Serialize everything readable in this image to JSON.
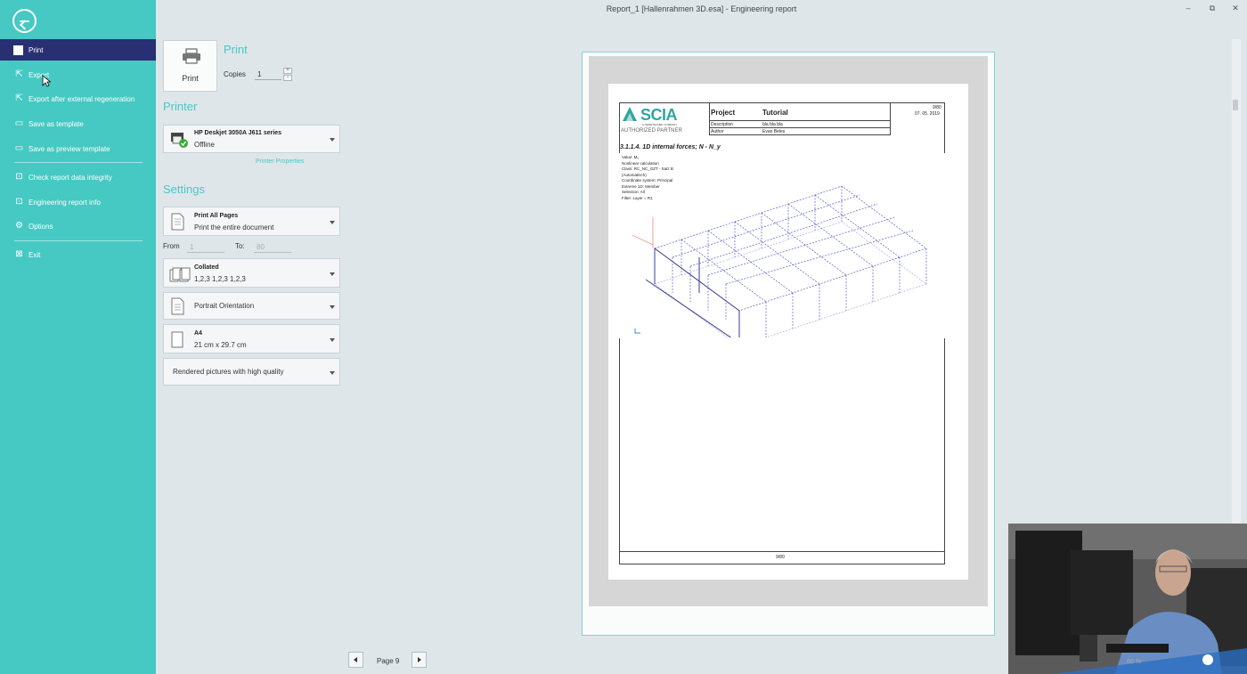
{
  "window": {
    "title": "Report_1 [Hallenrahmen 3D.esa] - Engineering report",
    "minimize": "–",
    "restore": "⧉",
    "close": "✕"
  },
  "sidebar": {
    "items": [
      {
        "label": "Print",
        "icon": "print-square-icon",
        "active": true
      },
      {
        "label": "Export",
        "icon": "export-icon"
      },
      {
        "label": "Export after external regeneration",
        "icon": "export-regenerate-icon"
      },
      {
        "label": "Save as template",
        "icon": "save-template-icon"
      },
      {
        "label": "Save as preview template",
        "icon": "save-preview-template-icon"
      },
      {
        "label": "Check report data integrity",
        "icon": "check-integrity-icon"
      },
      {
        "label": "Engineering report info",
        "icon": "report-info-icon"
      },
      {
        "label": "Options",
        "icon": "gear-icon"
      },
      {
        "label": "Exit",
        "icon": "exit-icon"
      }
    ]
  },
  "print_section": {
    "title": "Print",
    "button_label": "Print",
    "copies_label": "Copies",
    "copies_value": "1",
    "spin_up": "+",
    "spin_down": "-"
  },
  "printer_section": {
    "title": "Printer",
    "name": "HP Deskjet 3050A J611 series",
    "status": "Offline",
    "properties_link": "Printer Properties"
  },
  "settings_section": {
    "title": "Settings",
    "pages": {
      "title": "Print All Pages",
      "sub": "Print the entire document"
    },
    "from_label": "From",
    "from_value": "1",
    "to_label": "To:",
    "to_value": "80",
    "collation": {
      "title": "Collated",
      "sub": "1,2,3  1,2,3  1,2,3"
    },
    "orientation": "Portrait Orientation",
    "paper": {
      "title": "A4",
      "sub": "21 cm x 29.7 cm"
    },
    "quality": "Rendered pictures with high quality"
  },
  "preview": {
    "logo": "SCIA",
    "logo_tagline": "A NEMETSCHEK COMPANY",
    "partner": "AUTHORIZED PARTNER",
    "project_label": "Project",
    "project_value": "Tutorial",
    "page_num": "9/80",
    "date": "07. 05. 2019",
    "description_label": "Description",
    "description_value": "bla bla bla",
    "author_label": "Author",
    "author_value": "Evan Beles",
    "section_heading": "3.1.1.4.  1D internal forces; N - N_y",
    "params": [
      "Value: Mᵧ",
      "Nonlinear calculation",
      "Class: RC_NC_GZT - Satz B",
      "(Automatisch)",
      "Coordinate system: Principal",
      "Extreme 1D: Member",
      "Selection: All",
      "Filter: Layer = R1"
    ],
    "footer_page": "9/80"
  },
  "pager": {
    "label": "Page 9"
  },
  "zoom": "60 %",
  "colors": {
    "sidebar": "#46c8c3",
    "active_item": "#2a2f73",
    "accent": "#46c8c3",
    "background": "#dfe6ea",
    "structure": "#5b5bc8",
    "annotation": "#e0452e"
  }
}
